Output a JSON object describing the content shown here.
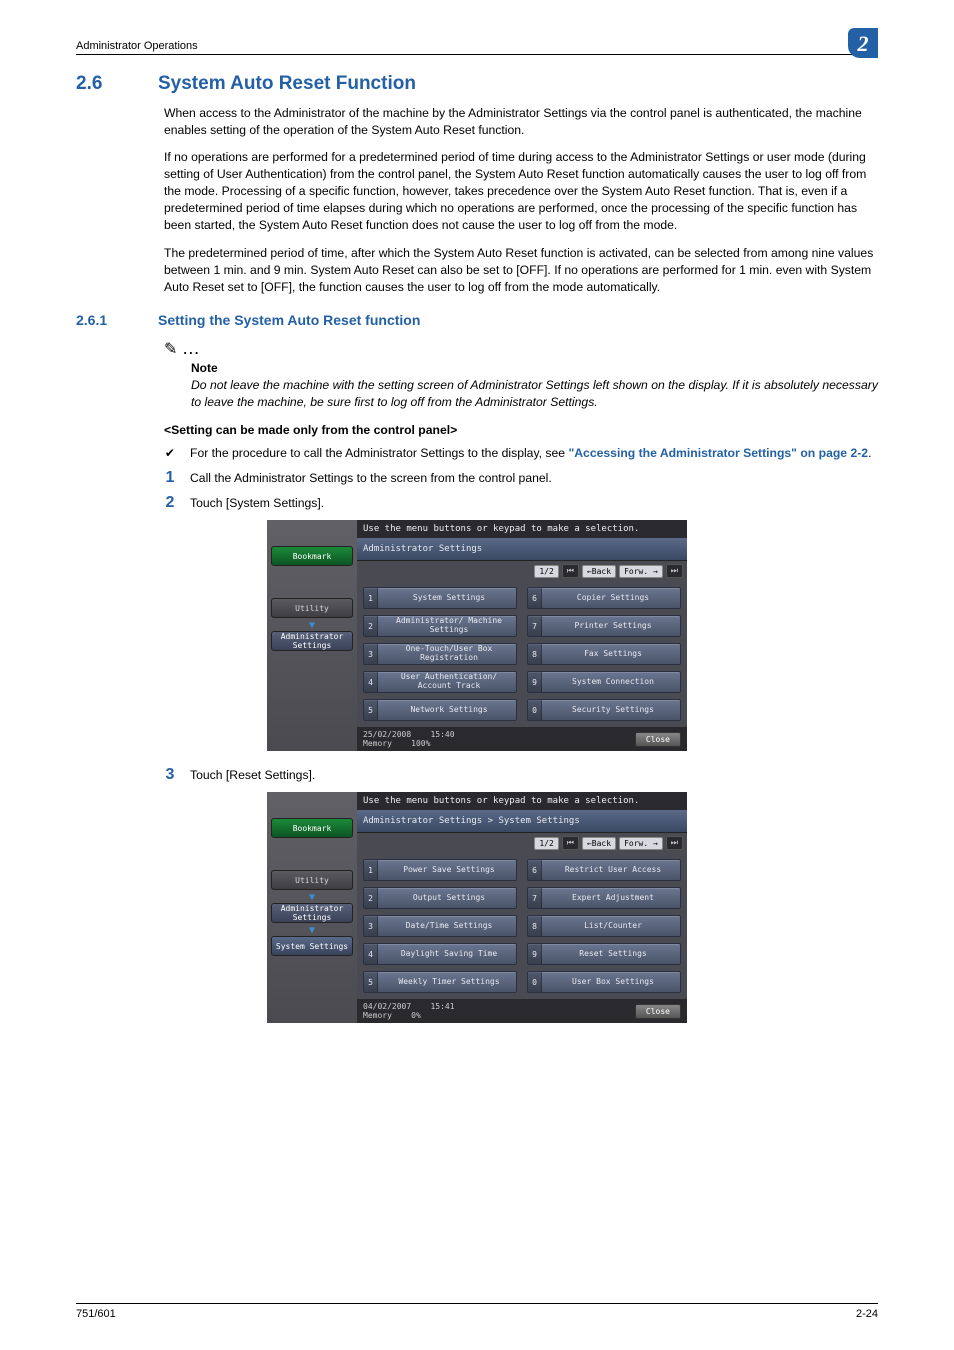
{
  "header": {
    "running": "Administrator Operations",
    "chapter_badge": "2"
  },
  "section": {
    "number": "2.6",
    "title": "System Auto Reset Function",
    "para1": "When access to the Administrator of the machine by the Administrator Settings via the control panel is authenticated, the machine enables setting of the operation of the System Auto Reset function.",
    "para2": "If no operations are performed for a predetermined period of time during access to the Administrator Settings or user mode (during setting of User Authentication) from the control panel, the System Auto Reset function automatically causes the user to log off from the mode. Processing of a specific function, however, takes precedence over the System Auto Reset function. That is, even if a predetermined period of time elapses during which no operations are performed, once the processing of the specific function has been started, the System Auto Reset function does not cause the user to log off from the mode.",
    "para3": "The predetermined period of time, after which the System Auto Reset function is activated, can be selected from among nine values between 1 min. and 9 min. System Auto Reset can also be set to [OFF]. If no operations are performed for 1 min. even with System Auto Reset set to [OFF], the function causes the user to log off from the mode automatically."
  },
  "subsection": {
    "number": "2.6.1",
    "title": "Setting the System Auto Reset function"
  },
  "note": {
    "label": "Note",
    "text": "Do not leave the machine with the setting screen of Administrator Settings left shown on the display. If it is absolutely necessary to leave the machine, be sure first to log off from the Administrator Settings."
  },
  "subhead": "<Setting can be made only from the control panel>",
  "procedure": {
    "check_pre": "For the procedure to call the Administrator Settings to the display, see ",
    "check_link": "\"Accessing the Administrator Settings\" on page 2-2",
    "check_post": ".",
    "step1": "Call the Administrator Settings to the screen from the control panel.",
    "step2": "Touch [System Settings].",
    "step3": "Touch [Reset Settings]."
  },
  "screen1": {
    "top": "Use the menu buttons or keypad to make a selection.",
    "crumb": "Administrator Settings",
    "bookmark": "Bookmark",
    "side_utility": "Utility",
    "side_admin": "Administrator Settings",
    "page": "1/2",
    "back": "←Back",
    "fwd": "Forw. →",
    "buttons": [
      {
        "n": "1",
        "t": "System Settings"
      },
      {
        "n": "6",
        "t": "Copier Settings"
      },
      {
        "n": "2",
        "t": "Administrator/\nMachine Settings"
      },
      {
        "n": "7",
        "t": "Printer Settings"
      },
      {
        "n": "3",
        "t": "One-Touch/User Box\nRegistration"
      },
      {
        "n": "8",
        "t": "Fax Settings"
      },
      {
        "n": "4",
        "t": "User Authentication/\nAccount Track"
      },
      {
        "n": "9",
        "t": "System Connection"
      },
      {
        "n": "5",
        "t": "Network Settings"
      },
      {
        "n": "0",
        "t": "Security Settings"
      }
    ],
    "date": "25/02/2008",
    "time": "15:40",
    "mem_label": "Memory",
    "mem_val": "100%",
    "close": "Close"
  },
  "screen2": {
    "top": "Use the menu buttons or keypad to make a selection.",
    "crumb": "Administrator Settings > System Settings",
    "bookmark": "Bookmark",
    "side_utility": "Utility",
    "side_admin": "Administrator Settings",
    "side_sys": "System Settings",
    "page": "1/2",
    "back": "←Back",
    "fwd": "Forw. →",
    "buttons": [
      {
        "n": "1",
        "t": "Power Save Settings"
      },
      {
        "n": "6",
        "t": "Restrict User Access"
      },
      {
        "n": "2",
        "t": "Output Settings"
      },
      {
        "n": "7",
        "t": "Expert Adjustment"
      },
      {
        "n": "3",
        "t": "Date/Time Settings"
      },
      {
        "n": "8",
        "t": "List/Counter"
      },
      {
        "n": "4",
        "t": "Daylight Saving Time"
      },
      {
        "n": "9",
        "t": "Reset Settings"
      },
      {
        "n": "5",
        "t": "Weekly Timer Settings"
      },
      {
        "n": "0",
        "t": "User Box Settings"
      }
    ],
    "date": "04/02/2007",
    "time": "15:41",
    "mem_label": "Memory",
    "mem_val": "0%",
    "close": "Close"
  },
  "footer": {
    "left": "751/601",
    "right": "2-24"
  }
}
